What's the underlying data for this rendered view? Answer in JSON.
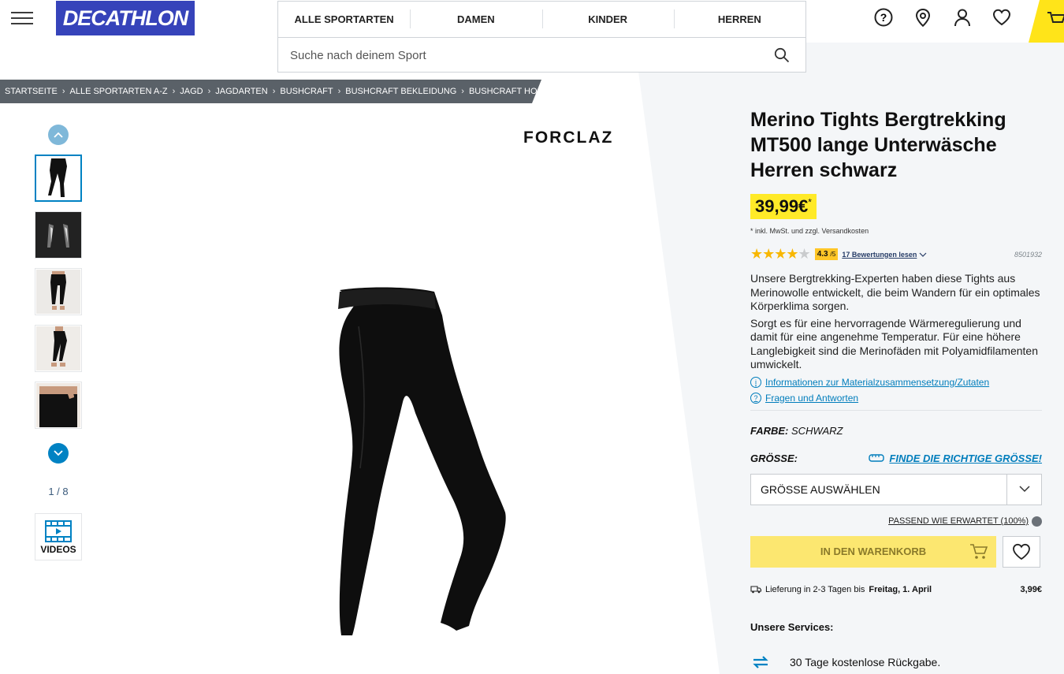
{
  "header": {
    "logo": "DECATHLON",
    "nav_tabs": [
      "ALLE SPORTARTEN",
      "DAMEN",
      "KINDER",
      "HERREN"
    ],
    "search_placeholder": "Suche nach deinem Sport"
  },
  "breadcrumb": [
    "STARTSEITE",
    "ALLE SPORTARTEN A-Z",
    "JAGD",
    "JAGDARTEN",
    "BUSHCRAFT",
    "BUSHCRAFT BEKLEIDUNG",
    "BUSHCRAFT HOSEN, SHORTS"
  ],
  "gallery": {
    "counter": "1 / 8",
    "videos_label": "VIDEOS",
    "brand": "FORCLAZ"
  },
  "product": {
    "title": "Merino Tights Bergtrekking MT500 lange Unterwäsche Herren schwarz",
    "price": "39,99€",
    "price_star": "*",
    "vat_note": "* inkl. MwSt. und zzgl. Versandkosten",
    "rating_value": 4.3,
    "rating_score": "4.3",
    "rating_scale": "/5",
    "reviews_link": "17 Bewertungen lesen",
    "ref": "8501932",
    "desc1": "Unsere Bergtrekking-Experten haben diese Tights aus Merinowolle entwickelt, die beim Wandern für ein optimales Körperklima sorgen.",
    "desc2": "Sorgt es für eine hervorragende Wärmeregulierung und damit für eine angenehme Temperatur. Für eine höhere Langlebigkeit sind die Merinofäden mit Polyamidfilamenten umwickelt.",
    "link_material": "Informationen zur Materialzusammensetzung/Zutaten",
    "link_faq": "Fragen und Antworten",
    "color_label": "FARBE:",
    "color_value": "SCHWARZ",
    "size_label": "GRÖSSE:",
    "size_guide": "FINDE DIE RICHTIGE GRÖSSE!",
    "size_select": "GRÖSSE AUSWÄHLEN",
    "fit_note": "PASSEND WIE ERWARTET (100%)",
    "add_to_cart": "IN DEN WARENKORB",
    "delivery_prefix": "Lieferung in 2-3 Tagen bis",
    "delivery_date": "Freitag, 1. April",
    "delivery_cost": "3,99€",
    "services_title": "Unsere Services:",
    "service_return": "30 Tage kostenlose Rückgabe."
  },
  "colors": {
    "brand_blue": "#3643ba",
    "accent_yellow": "#ffea28",
    "link_blue": "#007dbc"
  }
}
